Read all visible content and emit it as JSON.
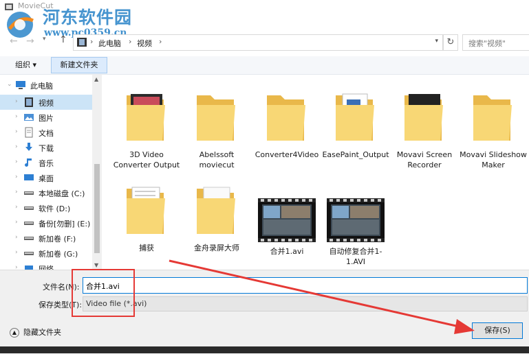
{
  "window": {
    "title": "MovieCut"
  },
  "watermark": {
    "text": "河东软件园",
    "url": "www.pc0359.cn"
  },
  "address": {
    "crumbs": [
      "此电脑",
      "视频"
    ],
    "search_placeholder": "搜索\"视频\""
  },
  "toolbar": {
    "organize_label": "组织 ▾",
    "new_folder_label": "新建文件夹"
  },
  "sidebar": {
    "items": [
      {
        "label": "此电脑",
        "icon": "computer-icon"
      },
      {
        "label": "视频",
        "icon": "video-folder-icon",
        "selected": true
      },
      {
        "label": "图片",
        "icon": "pictures-folder-icon"
      },
      {
        "label": "文档",
        "icon": "documents-folder-icon"
      },
      {
        "label": "下载",
        "icon": "download-folder-icon"
      },
      {
        "label": "音乐",
        "icon": "music-folder-icon"
      },
      {
        "label": "桌面",
        "icon": "desktop-folder-icon"
      },
      {
        "label": "本地磁盘 (C:)",
        "icon": "drive-icon"
      },
      {
        "label": "软件 (D:)",
        "icon": "drive-icon"
      },
      {
        "label": "备份[勿删] (E:)",
        "icon": "drive-icon"
      },
      {
        "label": "新加卷 (F:)",
        "icon": "drive-icon"
      },
      {
        "label": "新加卷 (G:)",
        "icon": "drive-icon"
      },
      {
        "label": "网络",
        "icon": "network-icon"
      }
    ]
  },
  "files": [
    {
      "label": "3D Video Converter Output",
      "kind": "folder-with-thumb"
    },
    {
      "label": "Abelssoft moviecut",
      "kind": "folder"
    },
    {
      "label": "Converter4Video",
      "kind": "folder"
    },
    {
      "label": "EasePaint_Output",
      "kind": "folder-with-doc"
    },
    {
      "label": "Movavi Screen Recorder",
      "kind": "folder-with-thumb2"
    },
    {
      "label": "Movavi Slideshow Maker",
      "kind": "folder"
    },
    {
      "label": "捕获",
      "kind": "folder-with-paper"
    },
    {
      "label": "金舟录屏大师",
      "kind": "folder-with-paper2"
    },
    {
      "label": "合并1.avi",
      "kind": "video"
    },
    {
      "label": "自动修复合并1-1.AVI",
      "kind": "video"
    }
  ],
  "footer": {
    "filename_label": "文件名(N):",
    "filename_value": "合并1.avi",
    "filetype_label": "保存类型(T):",
    "filetype_value": "Video file (*.avi)",
    "hide_folders_label": "隐藏文件夹",
    "save_label": "保存(S)"
  },
  "colors": {
    "accent": "#0078d7",
    "annotation": "#e53935",
    "folder": "#f8d775"
  }
}
